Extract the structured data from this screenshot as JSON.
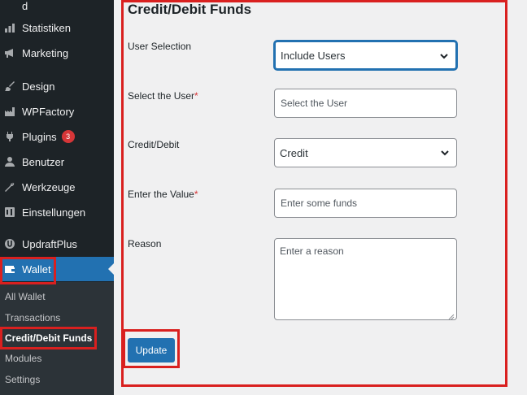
{
  "sidebar": {
    "top_cut_label": "d",
    "items": [
      {
        "label": "Statistiken"
      },
      {
        "label": "Marketing"
      },
      {
        "label": "Design"
      },
      {
        "label": "WPFactory"
      },
      {
        "label": "Plugins",
        "badge": "3"
      },
      {
        "label": "Benutzer"
      },
      {
        "label": "Werkzeuge"
      },
      {
        "label": "Einstellungen"
      },
      {
        "label": "UpdraftPlus"
      },
      {
        "label": "Wallet"
      }
    ],
    "submenu": [
      {
        "label": "All Wallet"
      },
      {
        "label": "Transactions"
      },
      {
        "label": "Credit/Debit Funds"
      },
      {
        "label": "Modules"
      },
      {
        "label": "Settings"
      }
    ]
  },
  "form": {
    "title": "Credit/Debit Funds",
    "user_selection_label": "User Selection",
    "user_selection_value": "Include Users",
    "select_user_label": "Select the User",
    "select_user_placeholder": "Select the User",
    "credit_debit_label": "Credit/Debit",
    "credit_debit_value": "Credit",
    "value_label": "Enter the Value",
    "value_placeholder": "Enter some funds",
    "reason_label": "Reason",
    "reason_placeholder": "Enter a reason",
    "required_mark": "*",
    "update_button": "Update"
  },
  "colors": {
    "sidebar_bg": "#1d2327",
    "accent": "#2271b1",
    "highlight_box": "#d9201f",
    "badge": "#d63638"
  }
}
